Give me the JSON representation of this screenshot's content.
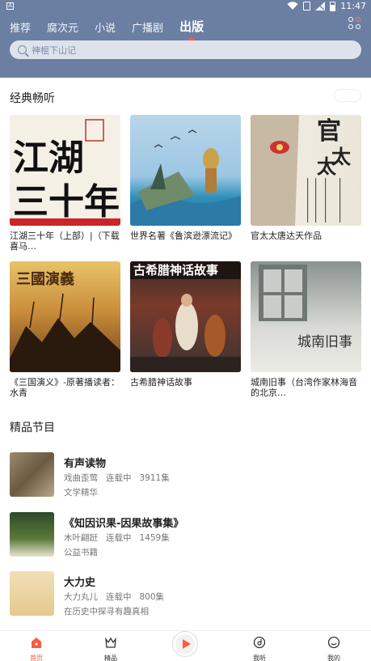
{
  "status_bar": {
    "time": "11:47",
    "left_badge": "A"
  },
  "tabs": [
    {
      "label": "推荐"
    },
    {
      "label": "腐次元"
    },
    {
      "label": "小说"
    },
    {
      "label": "广播剧"
    },
    {
      "label": "出版",
      "active": true
    }
  ],
  "search": {
    "placeholder": "神棍下山记"
  },
  "classic": {
    "title": "经典畅听",
    "books": [
      {
        "title": "江湖三十年（上部）|（下载喜马…",
        "cover_text": "江湖三十年"
      },
      {
        "title": "世界名著《鲁滨逊漂流记》",
        "cover_text": ""
      },
      {
        "title": "官太太唐达天作品",
        "cover_text": "官太太"
      },
      {
        "title": "《三国演义》-原著播读者：水青",
        "cover_text": "三国演义"
      },
      {
        "title": "古希腊神话故事",
        "cover_text": "古希腊神话故事"
      },
      {
        "title": "城南旧事（台湾作家林海音的北京…",
        "cover_text": "城南旧事"
      }
    ]
  },
  "featured": {
    "title": "精品节目",
    "programs": [
      {
        "title": "有声读物",
        "author": "戏曲歪莺",
        "status": "连载中",
        "episodes": "3911集",
        "desc": "文学精华"
      },
      {
        "title": "《知因识果-因果故事集》",
        "author": "木叶翩跹",
        "status": "连载中",
        "episodes": "1459集",
        "desc": "公益书籍"
      },
      {
        "title": "大力史",
        "author": "大力丸儿",
        "status": "连载中",
        "episodes": "800集",
        "desc": "在历史中探寻有趣真相"
      }
    ]
  },
  "bottom_nav": {
    "items": [
      {
        "label": "首页",
        "icon": "home-icon",
        "active": true
      },
      {
        "label": "精品",
        "icon": "crown-icon"
      },
      {
        "label": "",
        "icon": "play-icon"
      },
      {
        "label": "我听",
        "icon": "listen-icon"
      },
      {
        "label": "我的",
        "icon": "profile-icon"
      }
    ]
  },
  "colors": {
    "header": "#6b7fa3",
    "accent": "#ff5a3c"
  }
}
